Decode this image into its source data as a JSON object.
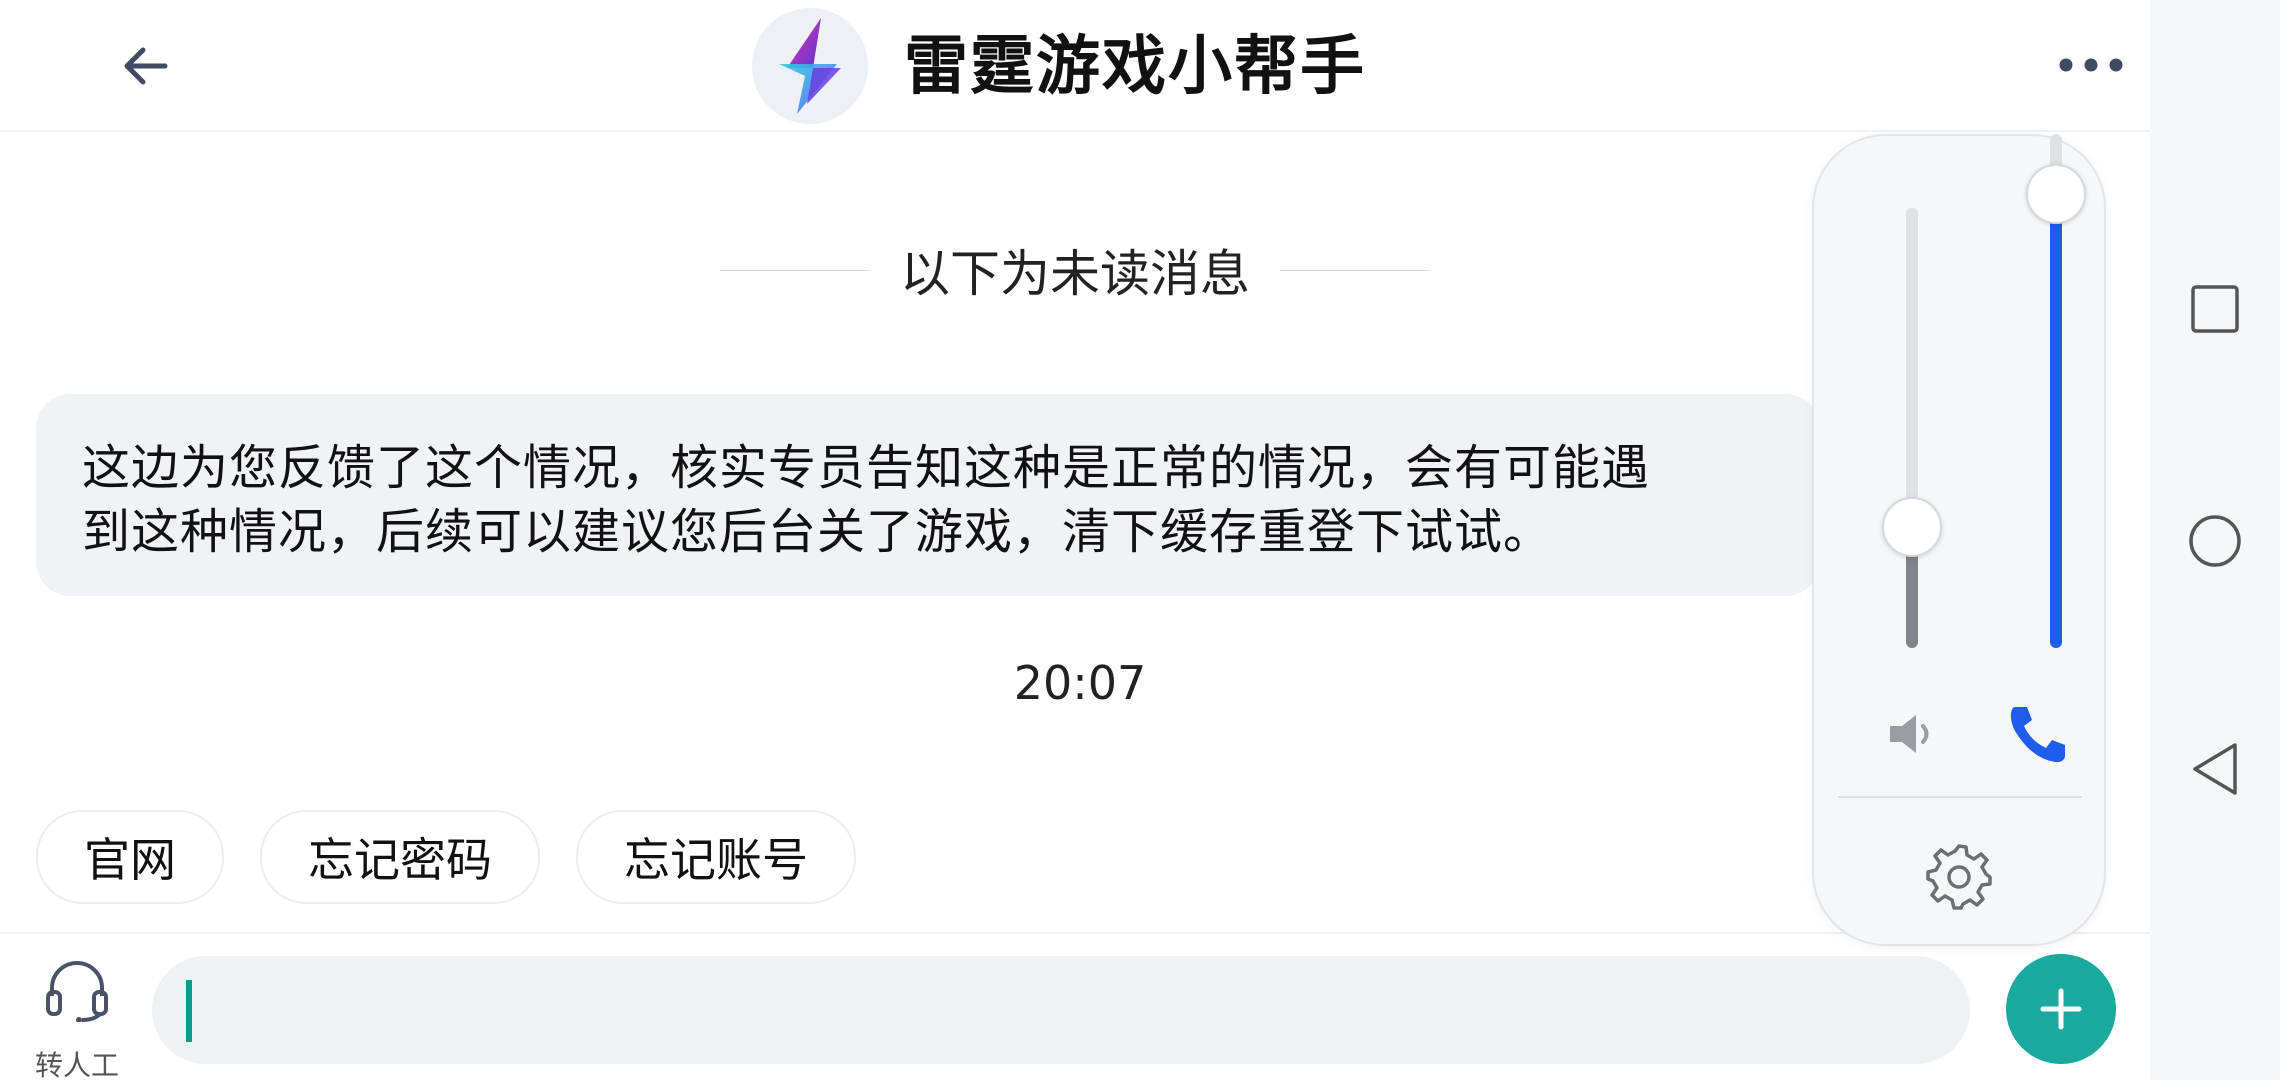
{
  "header": {
    "title": "雷霆游戏小帮手",
    "back_icon": "arrow-left-icon",
    "more_icon": "more-horizontal-icon",
    "avatar_icon": "lightning-bolt-logo"
  },
  "chat": {
    "unread_divider": "以下为未读消息",
    "message": {
      "line1": "这边为您反馈了这个情况，核实专员告知这种是正常的情况，会有可能遇",
      "line2": "到这种情况，后续可以建议您后台关了游戏，清下缓存重登下试试。"
    },
    "timestamp": "20:07"
  },
  "quick_replies": [
    {
      "label": "官网"
    },
    {
      "label": "忘记密码"
    },
    {
      "label": "忘记账号"
    }
  ],
  "input_bar": {
    "agent_label": "转人工",
    "input_value": "",
    "plus_icon": "plus-icon"
  },
  "volume_panel": {
    "media_level": 0.28,
    "call_level": 1.0,
    "media_icon": "speaker-icon",
    "call_icon": "phone-icon",
    "settings_icon": "gear-icon"
  },
  "colors": {
    "accent_teal": "#19a99d",
    "call_slider_blue": "#1e5eea",
    "media_slider_gray": "#808389"
  },
  "system_nav": [
    "square-recents-icon",
    "circle-home-icon",
    "triangle-back-icon"
  ]
}
